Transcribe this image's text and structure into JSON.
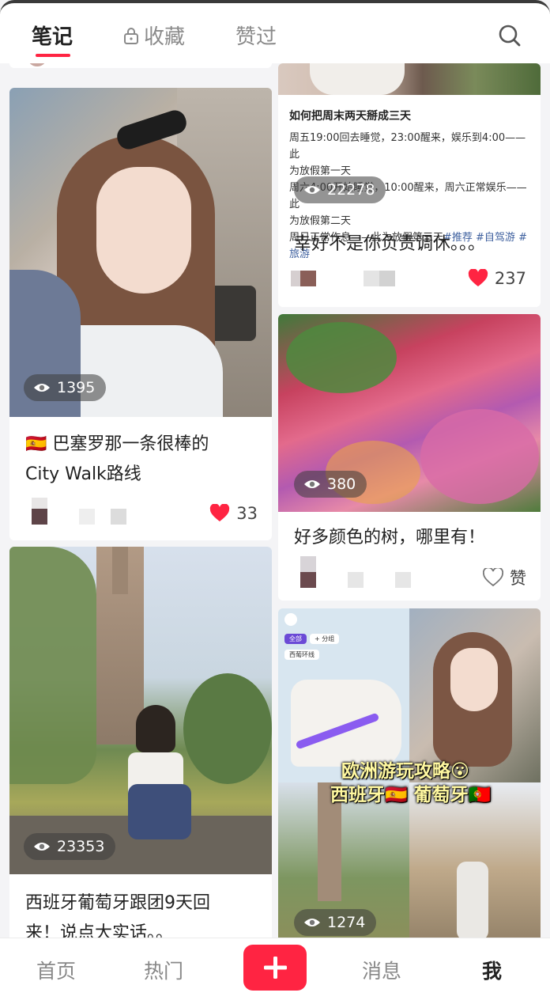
{
  "tabs": {
    "notes": "笔记",
    "collections": "收藏",
    "liked": "赞过"
  },
  "cards": {
    "itinerary_note": {
      "heading": "如何把周末两天掰成三天",
      "lines": [
        "周五19:00回去睡觉，23:00醒来，娱乐到4:00——此",
        "为放假第一天",
        "周六4:00开始睡觉，10:00醒来，周六正常娱乐——此",
        "为放假第二天",
        "周日正常作息——此为放假第三天"
      ],
      "tags": "#推荐 #自驾游 #",
      "tag_last": "旅游",
      "views": "22278",
      "title": "幸好不是你负责调休。。。",
      "likes": "237"
    },
    "barcelona": {
      "flag": "🇪🇸",
      "title_line1": "巴塞罗那一条很棒的",
      "title_line2": "City Walk路线",
      "views": "1395",
      "likes": "33"
    },
    "trees": {
      "views": "380",
      "title": "好多颜色的树，哪里有！",
      "like_label": "赞"
    },
    "spain_tour": {
      "views": "23353",
      "title_line1": "西班牙葡萄牙跟团9天回",
      "title_line2": "来！说点大实话。。"
    },
    "europe_guide": {
      "overlay_line1": "欧洲游玩攻略😮",
      "overlay_line2a": "西班牙🇪🇸",
      "overlay_line2b": "葡萄牙🇵🇹",
      "views": "1274",
      "map_chip_1": "全部",
      "map_chip_2": "+ 分组",
      "map_chip_3": "西葡环线"
    }
  },
  "bottom_nav": {
    "home": "首页",
    "hot": "热门",
    "messages": "消息",
    "me": "我"
  },
  "colors": {
    "accent": "#ff2442",
    "tag": "#3d5f9e"
  }
}
